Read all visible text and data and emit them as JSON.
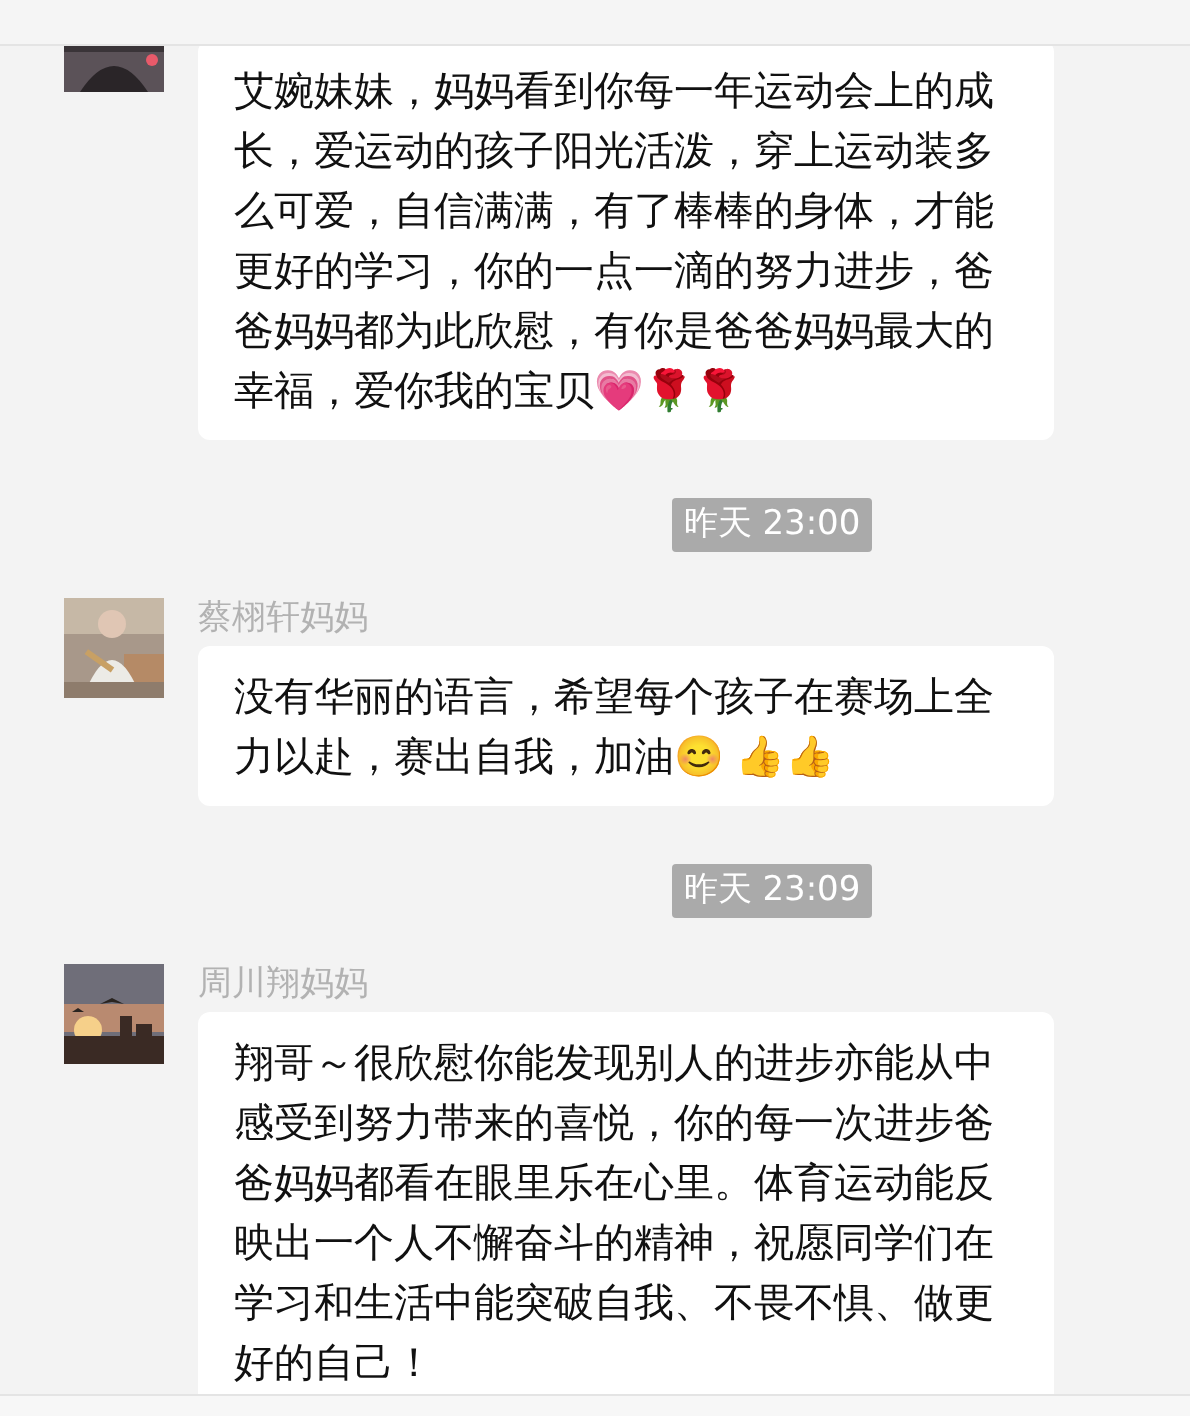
{
  "chat": [
    {
      "kind": "message",
      "text": "艾婉妹妹，妈妈看到你每一年运动会上的成长，爱运动的孩子阳光活泼，穿上运动装多么可爱，自信满满，有了棒棒的身体，才能更好的学习，你的一点一滴的努力进步，爸爸妈妈都为此欣慰，有你是爸爸妈妈最大的幸福，爱你我的宝贝💗🌹🌹"
    },
    {
      "kind": "time",
      "text": "昨天 23:00"
    },
    {
      "kind": "message",
      "sender": "蔡栩轩妈妈",
      "text": "没有华丽的语言，希望每个孩子在赛场上全力以赴，赛出自我，加油😊 👍👍"
    },
    {
      "kind": "time",
      "text": "昨天 23:09"
    },
    {
      "kind": "message",
      "sender": "周川翔妈妈",
      "text": "翔哥～很欣慰你能发现别人的进步亦能从中感受到努力带来的喜悦，你的每一次进步爸爸妈妈都看在眼里乐在心里。体育运动能反映出一个人不懈奋斗的精神，祝愿同学们在学习和生活中能突破自我、不畏不惧、做更好的自己！"
    }
  ]
}
